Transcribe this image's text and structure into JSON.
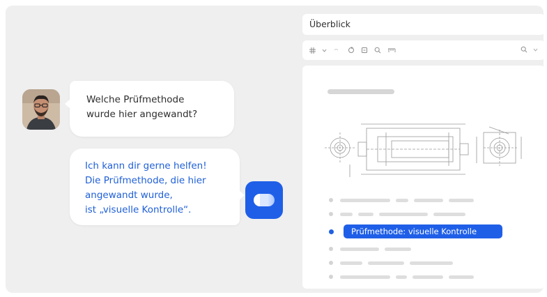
{
  "chat": {
    "user_message_line1": "Welche Prüfmethode",
    "user_message_line2": "wurde hier angewandt?",
    "bot_message_line1": "Ich kann dir gerne helfen!",
    "bot_message_line2": "Die Prüfmethode, die hier",
    "bot_message_line3": "angewandt wurde,",
    "bot_message_line4": "ist „visuelle Kontrolle“."
  },
  "panel": {
    "title": "Überblick",
    "toolbar_icons": [
      "grid-icon",
      "chevron-down-icon",
      "undo-icon",
      "refresh-icon",
      "fit-icon",
      "zoom-icon",
      "ruler-icon",
      "search-icon",
      "chevron-down-icon"
    ]
  },
  "document": {
    "highlight_text": "Prüfmethode: visuelle Kontrolle"
  },
  "colors": {
    "accent": "#1f5fe8",
    "bot_text": "#2060d8",
    "background": "#efefef"
  }
}
